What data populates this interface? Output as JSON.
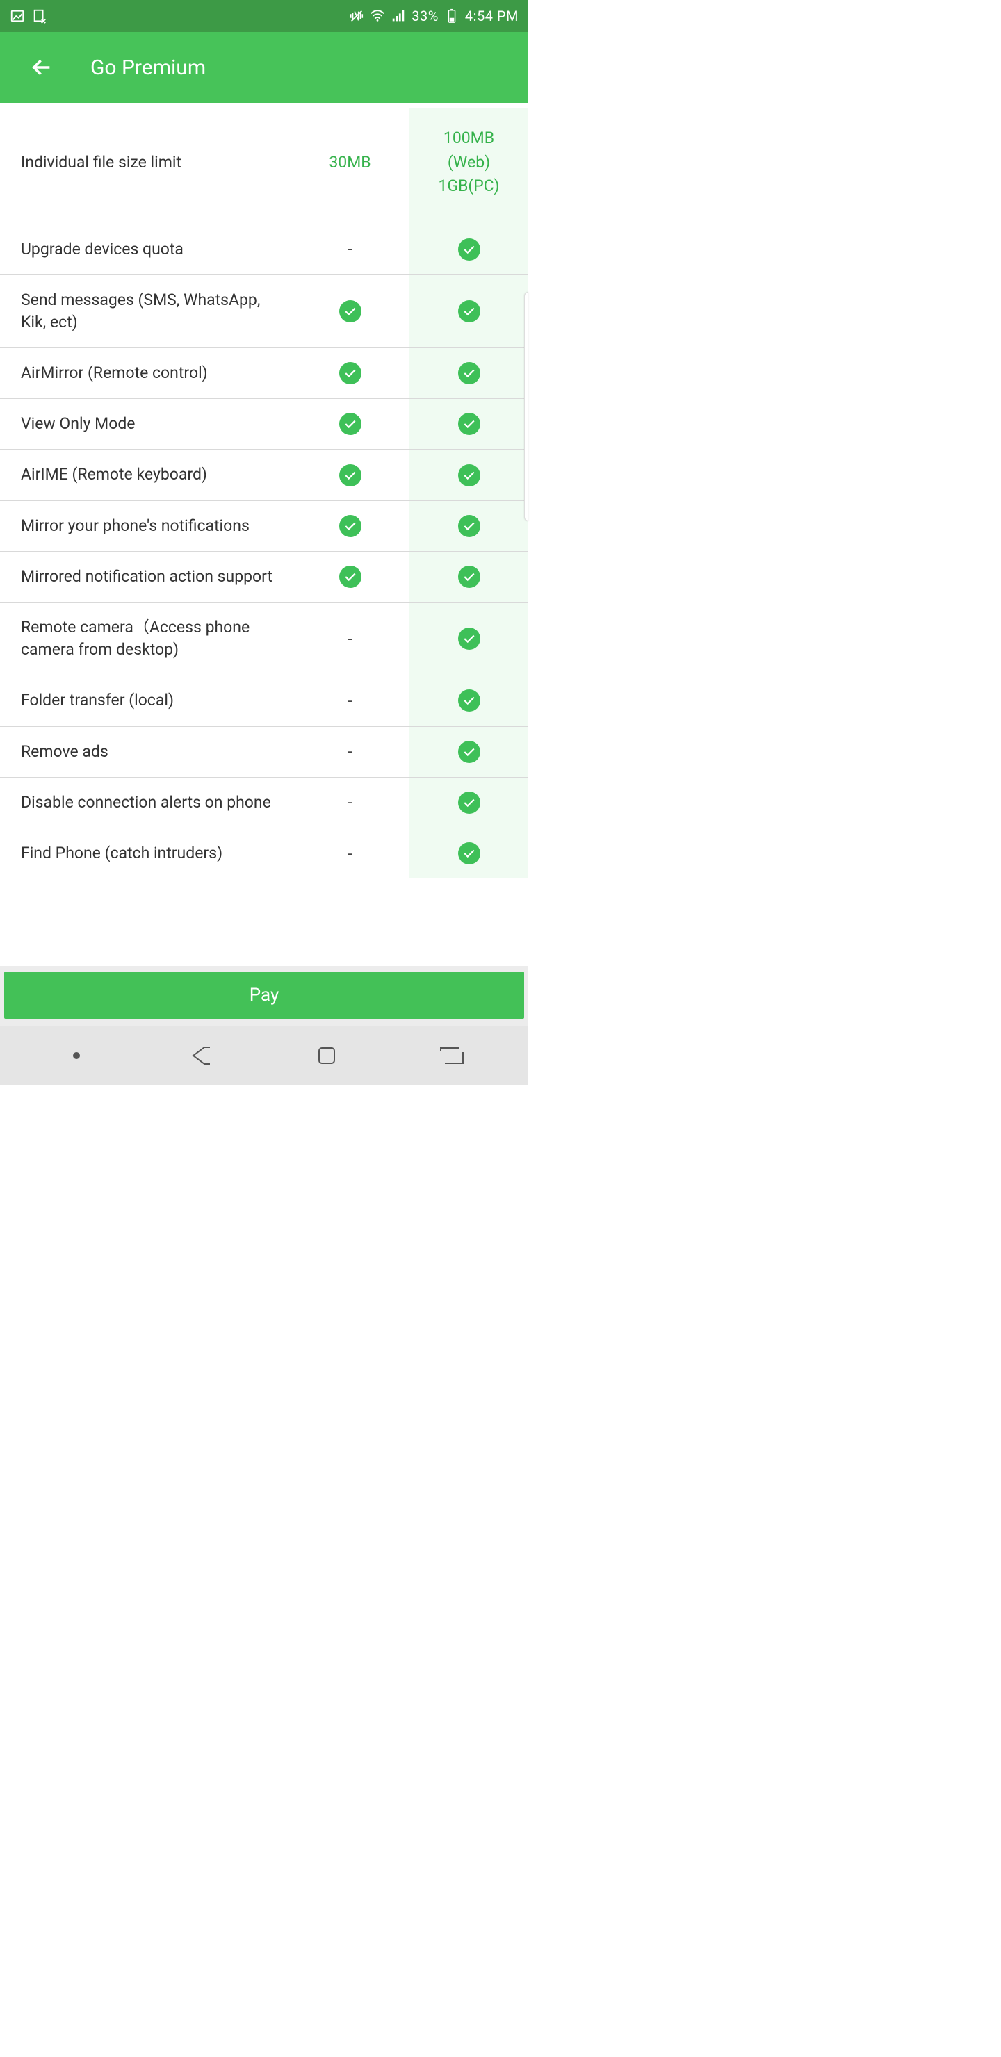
{
  "status": {
    "battery_text": "33%",
    "time": "4:54 PM"
  },
  "header": {
    "title": "Go Premium"
  },
  "rows": [
    {
      "label": "Individual file size limit",
      "free": "30MB",
      "premium": "100MB\n(Web)\n1GB(PC)",
      "type": "text"
    },
    {
      "label": "Upgrade devices quota",
      "free": "-",
      "premium": "check",
      "type": "mixed"
    },
    {
      "label": "Send messages (SMS, WhatsApp, Kik, ect)",
      "free": "check",
      "premium": "check",
      "type": "check"
    },
    {
      "label": "AirMirror (Remote control)",
      "free": "check",
      "premium": "check",
      "type": "check"
    },
    {
      "label": "View Only Mode",
      "free": "check",
      "premium": "check",
      "type": "check"
    },
    {
      "label": "AirIME (Remote keyboard)",
      "free": "check",
      "premium": "check",
      "type": "check"
    },
    {
      "label": "Mirror your phone's notifications",
      "free": "check",
      "premium": "check",
      "type": "check"
    },
    {
      "label": "Mirrored notification action support",
      "free": "check",
      "premium": "check",
      "type": "check"
    },
    {
      "label": "Remote camera（Access phone camera from desktop)",
      "free": "-",
      "premium": "check",
      "type": "mixed"
    },
    {
      "label": "Folder transfer (local)",
      "free": "-",
      "premium": "check",
      "type": "mixed"
    },
    {
      "label": "Remove ads",
      "free": "-",
      "premium": "check",
      "type": "mixed"
    },
    {
      "label": "Disable connection alerts on phone",
      "free": "-",
      "premium": "check",
      "type": "mixed"
    },
    {
      "label": "Find Phone (catch intruders)",
      "free": "-",
      "premium": "check",
      "type": "mixed"
    }
  ],
  "cta": {
    "label": "Pay"
  }
}
